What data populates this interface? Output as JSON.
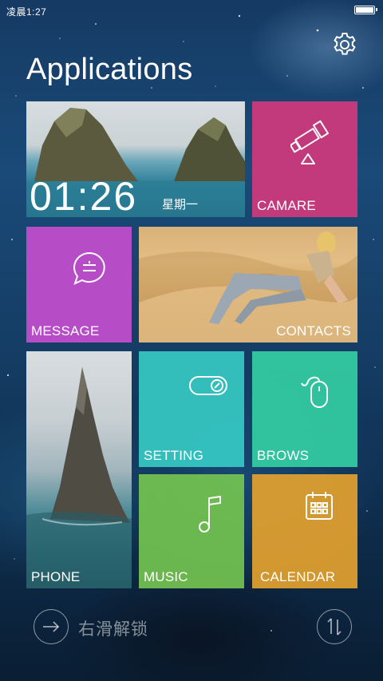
{
  "status_bar": {
    "time": "凌晨1:27",
    "battery_level": 1.0
  },
  "header": {
    "title": "Applications",
    "settings_icon": "gear-icon"
  },
  "tiles": {
    "clock": {
      "time": "01:26",
      "day": "星期一"
    },
    "camare": {
      "label": "CAMARE",
      "icon": "telescope-icon",
      "color": "#c23a7c"
    },
    "message": {
      "label": "MESSAGE",
      "icon": "chat-bubble-icon",
      "color": "#b64dc7"
    },
    "contacts": {
      "label": "CONTACTS"
    },
    "phone": {
      "label": "PHONE"
    },
    "setting": {
      "label": "SETTING",
      "icon": "toggle-icon",
      "color": "#38d0c8"
    },
    "brows": {
      "label": "BROWS",
      "icon": "mouse-icon",
      "color": "#34d0a4"
    },
    "music": {
      "label": "MUSIC",
      "icon": "music-note-icon",
      "color": "#76c650"
    },
    "calendar": {
      "label": "CALENDAR",
      "icon": "calendar-icon",
      "color": "#e2a02e"
    }
  },
  "footer": {
    "unlock_text": "右滑解锁",
    "unlock_icon": "arrow-right-icon",
    "swap_icon": "swap-vertical-icon"
  }
}
